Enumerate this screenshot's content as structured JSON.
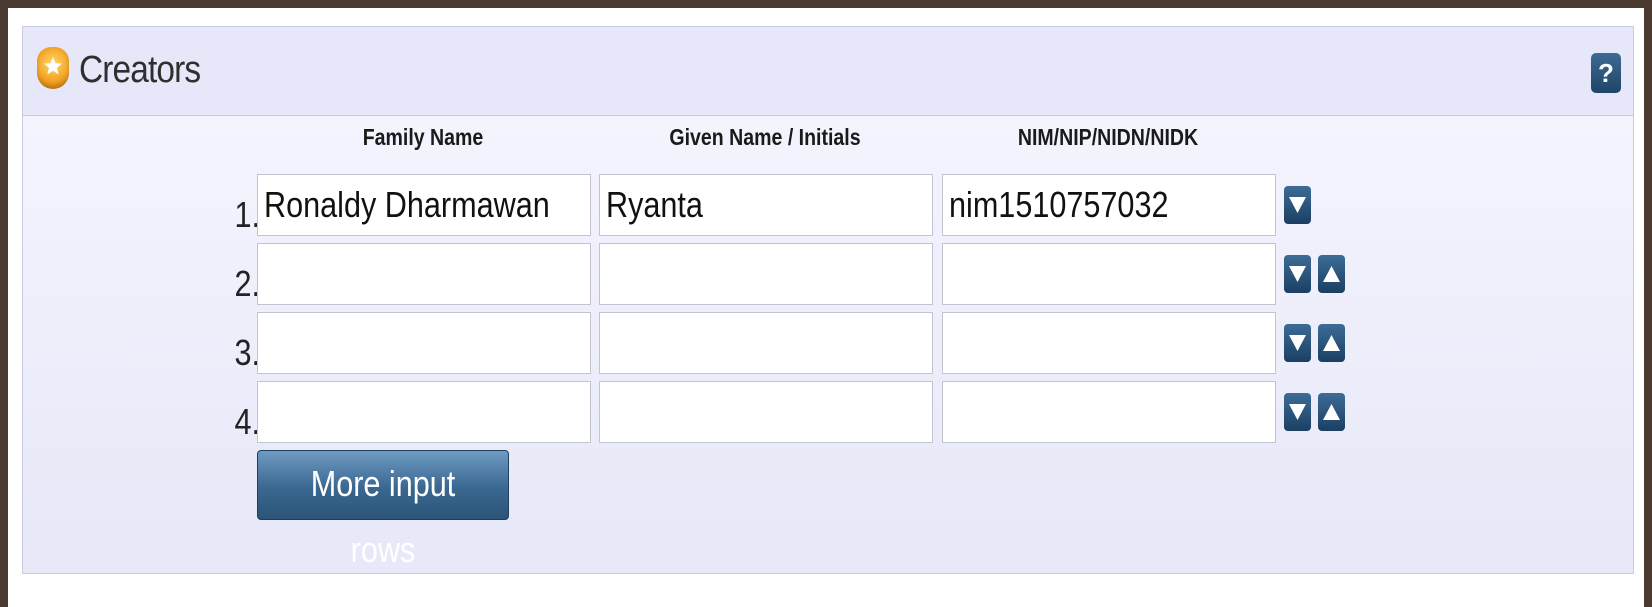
{
  "panel": {
    "title": "Creators",
    "help_label": "?"
  },
  "columns": {
    "family": "Family Name",
    "given": "Given Name / Initials",
    "id": "NIM/NIP/NIDN/NIDK"
  },
  "rows": [
    {
      "num": "1.",
      "family": "Ronaldy Dharmawan",
      "given": "Ryanta",
      "id": "nim1510757032"
    },
    {
      "num": "2.",
      "family": "",
      "given": "",
      "id": ""
    },
    {
      "num": "3.",
      "family": "",
      "given": "",
      "id": ""
    },
    {
      "num": "4.",
      "family": "",
      "given": "",
      "id": ""
    }
  ],
  "more_button": "More input rows",
  "colors": {
    "accent": "#2c5478",
    "panel_bg": "#e9eaf8"
  },
  "icons": {
    "title_icon": "star-icon",
    "help_icon": "help-icon",
    "move_down": "move-down-icon",
    "move_up": "move-up-icon"
  }
}
